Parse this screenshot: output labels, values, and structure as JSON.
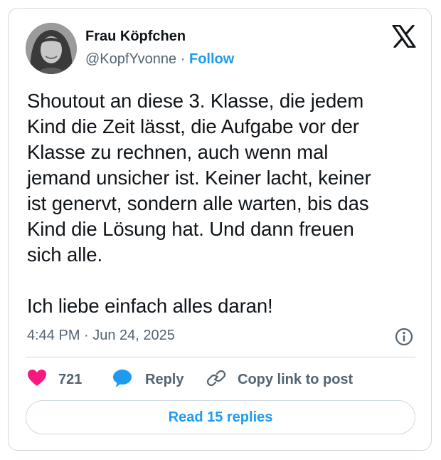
{
  "author": {
    "name": "Frau Köpfchen",
    "handle": "@KopfYvonne",
    "separator": "·",
    "follow_label": "Follow"
  },
  "tweet": {
    "text": "Shoutout an diese 3. Klasse, die jedem\nKind die Zeit lässt, die Aufgabe vor der\nKlasse zu rechnen, auch wenn mal\njemand unsicher ist. Keiner lacht, keiner\nist genervt, sondern alle warten, bis das\nKind die Lösung hat. Und dann freuen\nsich alle.\n\nIch liebe einfach alles daran!",
    "timestamp": "4:44 PM · Jun 24, 2025"
  },
  "actions": {
    "like_count": "721",
    "reply_label": "Reply",
    "copy_label": "Copy link to post"
  },
  "footer": {
    "read_replies_label": "Read 15 replies"
  },
  "icons": {
    "logo": "x-logo-icon",
    "info": "info-icon",
    "like": "heart-icon",
    "reply": "speech-bubble-icon",
    "copy": "link-icon"
  },
  "colors": {
    "accent": "#1d9bf0",
    "heart": "#f91880",
    "text": "#0f1419",
    "muted": "#536471",
    "border": "#cfd9de"
  }
}
